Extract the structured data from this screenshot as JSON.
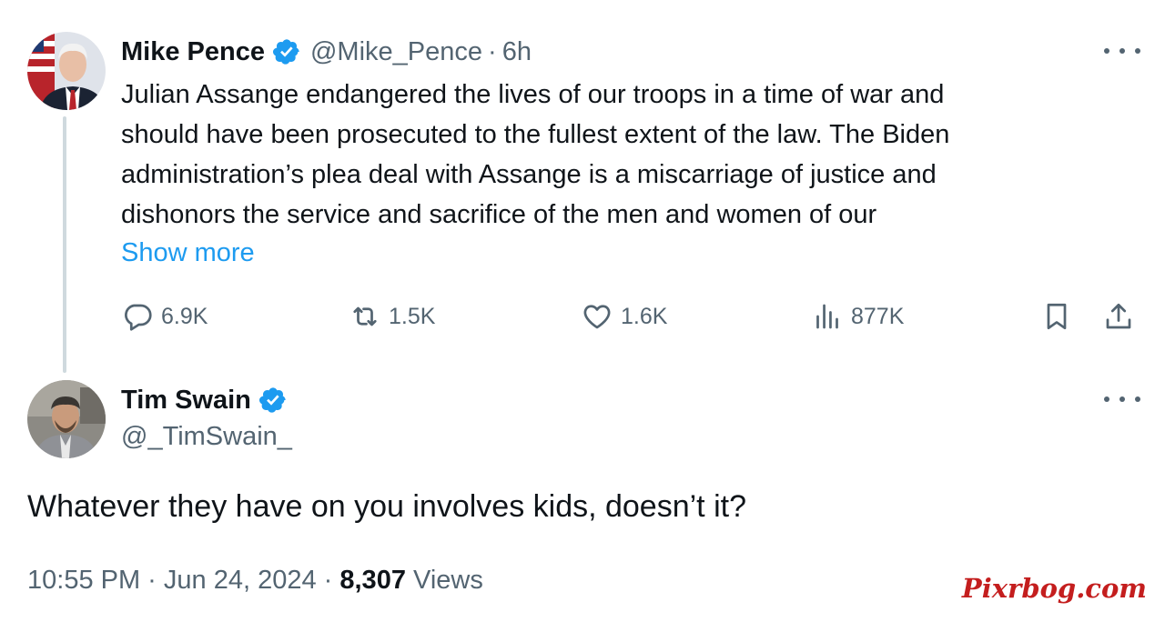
{
  "parent_tweet": {
    "author_name": "Mike Pence",
    "handle": "@Mike_Pence",
    "separator": "·",
    "time": "6h",
    "body_lines": [
      "Julian Assange endangered the lives of our troops in a time of war and",
      "should have been prosecuted to the fullest extent of the law. The Biden",
      "administration’s plea deal with Assange is a miscarriage of justice and",
      "dishonors the service and sacrifice of the men and women of our"
    ],
    "show_more": "Show more",
    "actions": {
      "replies": "6.9K",
      "retweets": "1.5K",
      "likes": "1.6K",
      "views": "877K"
    }
  },
  "reply_tweet": {
    "author_name": "Tim Swain",
    "handle": "@_TimSwain_",
    "text": "Whatever they have on you involves kids, doesn’t it?",
    "timestamp": "10:55 PM · Jun 24, 2024 ·",
    "views_count": "8,307",
    "views_label": "Views"
  },
  "watermark": "Pixrbog.com",
  "icons": {
    "verified": "verified-badge-icon",
    "reply": "reply-bubble-icon",
    "retweet": "retweet-icon",
    "like": "heart-icon",
    "views": "bar-chart-icon",
    "bookmark": "bookmark-icon",
    "share": "share-upload-icon",
    "more": "more-dots-icon"
  },
  "colors": {
    "accent": "#1d9bf0",
    "text": "#0f1419",
    "muted": "#536471",
    "thread_line": "#cfd9de",
    "watermark": "#c41e1e"
  }
}
